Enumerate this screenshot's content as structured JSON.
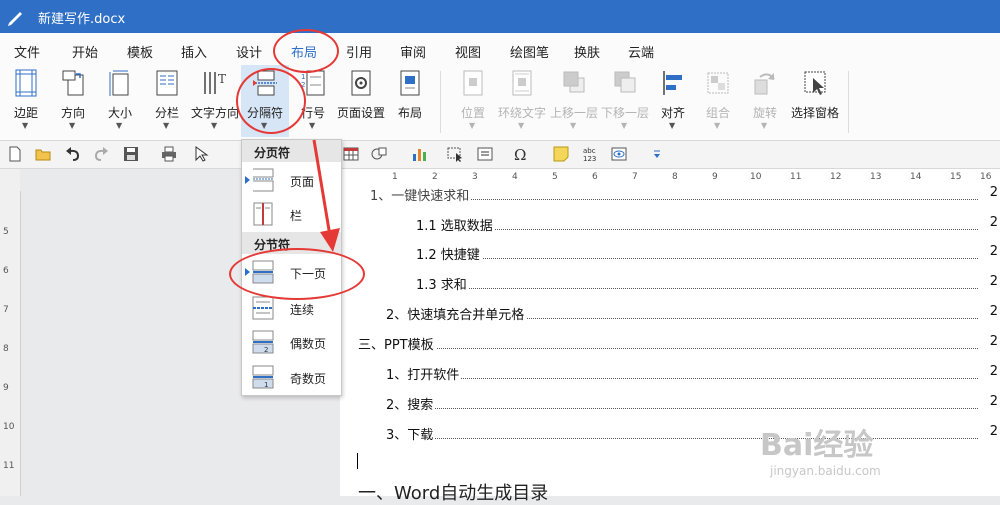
{
  "window": {
    "title": "新建写作.docx"
  },
  "menu": {
    "items": [
      "文件",
      "开始",
      "模板",
      "插入",
      "设计",
      "布局",
      "引用",
      "审阅",
      "视图",
      "绘图笔",
      "换肤",
      "云端"
    ],
    "active": "布局"
  },
  "ribbon": {
    "margins": "边距",
    "orientation": "方向",
    "size": "大小",
    "columns": "分栏",
    "text_direction": "文字方向",
    "breaks": "分隔符",
    "line_numbers": "行号",
    "page_setup": "页面设置",
    "layout": "布局",
    "position": "位置",
    "wrap_text": "环绕文字",
    "bring_forward": "上移一层",
    "send_backward": "下移一层",
    "align": "对齐",
    "group": "组合",
    "rotate": "旋转",
    "selection_pane": "选择窗格"
  },
  "breaks_menu": {
    "page_breaks_header": "分页符",
    "page": "页面",
    "column": "栏",
    "section_breaks_header": "分节符",
    "next_page": "下一页",
    "continuous": "连续",
    "even_page": "偶数页",
    "odd_page": "奇数页"
  },
  "ruler": {
    "h": [
      "1",
      "2",
      "3",
      "4",
      "5",
      "6",
      "7",
      "8",
      "9",
      "10",
      "11",
      "12",
      "13",
      "14",
      "15",
      "16"
    ],
    "v": [
      "4",
      "5",
      "6",
      "7",
      "8",
      "9",
      "10",
      "11"
    ]
  },
  "toc": [
    {
      "text": "1、一键快速求和",
      "page": "2"
    },
    {
      "text": "1.1  选取数据",
      "page": "2"
    },
    {
      "text": "1.2  快捷键",
      "page": "2"
    },
    {
      "text": "1.3  求和",
      "page": "2"
    },
    {
      "text": "2、快速填充合并单元格",
      "page": "2"
    },
    {
      "text": "三、PPT模板",
      "page": "2"
    },
    {
      "text": "1、打开软件",
      "page": "2"
    },
    {
      "text": "2、搜索",
      "page": "2"
    },
    {
      "text": "3、下载",
      "page": "2"
    }
  ],
  "doc_heading": "一、Word自动生成目录",
  "watermark": {
    "brand": "Bai经验",
    "url": "jingyan.baidu.com"
  },
  "colors": {
    "accent": "#2f6fc6",
    "annotation": "#e53935"
  }
}
